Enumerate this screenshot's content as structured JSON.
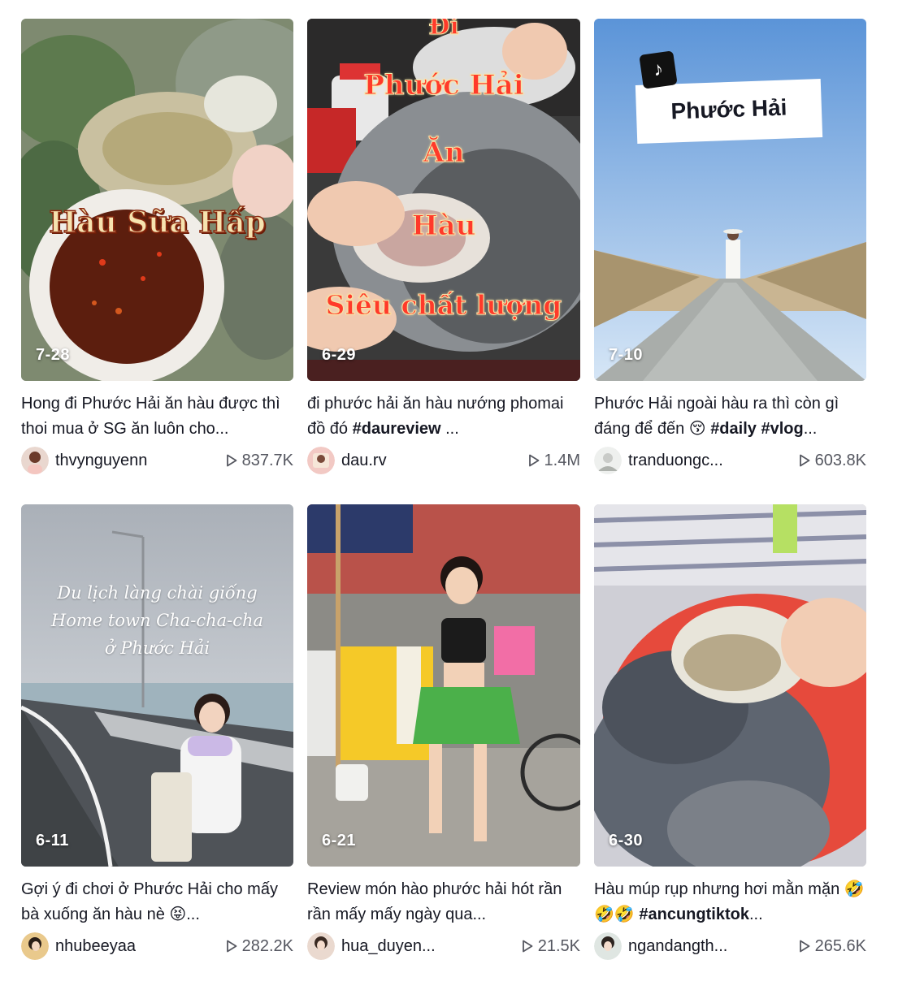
{
  "videos": [
    {
      "date": "7-28",
      "desc_plain": "Hong đi Phước Hải ăn hàu được thì thoi mua ở SG ăn luôn cho...",
      "desc_tag": "",
      "desc_tail": "",
      "username": "thvynguyenn",
      "views": "837.7K",
      "overlay": [
        "Hàu Sữa Hấp"
      ]
    },
    {
      "date": "6-29",
      "desc_plain": "đi phước hải ăn hàu nướng phomai đồ đó ",
      "desc_tag": "#daureview",
      "desc_tail": " ...",
      "username": "dau.rv",
      "views": "1.4M",
      "overlay": [
        "Đi",
        "Phước Hải",
        "Ăn",
        "Hàu",
        "Siêu chất lượng"
      ]
    },
    {
      "date": "7-10",
      "desc_plain": "Phước Hải ngoài hàu ra thì còn gì đáng để đến 😚 ",
      "desc_tag": "#daily #vlog",
      "desc_tail": "...",
      "username": "tranduongc...",
      "views": "603.8K",
      "overlay": [
        "Phước Hải"
      ]
    },
    {
      "date": "6-11",
      "desc_plain": "Gợi ý đi chơi ở Phước Hải cho mấy bà xuống ăn hàu nè 😝...",
      "desc_tag": "",
      "desc_tail": "",
      "username": "nhubeeyaa",
      "views": "282.2K",
      "overlay": [
        "Du lịch làng chài giống",
        "Home town Cha-cha-cha",
        "ở Phước Hải"
      ]
    },
    {
      "date": "6-21",
      "desc_plain": "Review món hào phước hải hót rần rần mấy mấy ngày qua...",
      "desc_tag": "",
      "desc_tail": "",
      "username": "hua_duyen...",
      "views": "21.5K",
      "overlay": []
    },
    {
      "date": "6-30",
      "desc_plain": "Hàu múp rụp nhưng hơi mằn mặn 🤣🤣🤣 ",
      "desc_tag": "#ancungtiktok",
      "desc_tail": "...",
      "username": "ngandangth...",
      "views": "265.6K",
      "overlay": []
    }
  ],
  "icons": {
    "play": "play-icon",
    "logo": "tiktok-logo-icon"
  }
}
